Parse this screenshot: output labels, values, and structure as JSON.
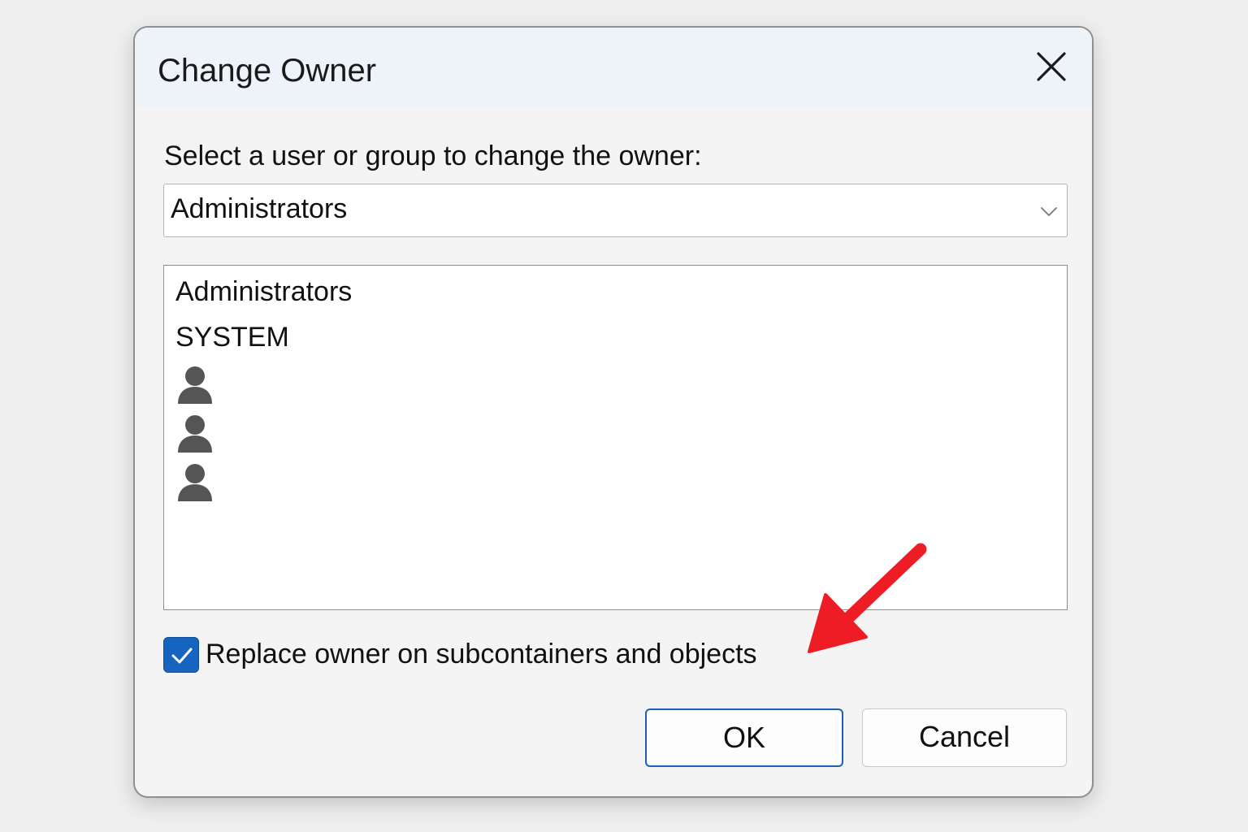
{
  "dialog": {
    "title": "Change Owner",
    "close_icon": "close-icon"
  },
  "owner_select": {
    "prompt": "Select a user or group to change the owner:",
    "selected_value": "Administrators",
    "chevron_icon": "chevron-down-icon"
  },
  "list": {
    "items": [
      {
        "label": "Administrators"
      },
      {
        "label": "SYSTEM"
      },
      {
        "icon": "user-icon"
      },
      {
        "icon": "user-icon"
      },
      {
        "icon": "user-icon"
      }
    ]
  },
  "replace_option": {
    "label": "Replace owner on subcontainers and objects",
    "checked": true,
    "check_color": "#1565c0"
  },
  "buttons": {
    "ok_label": "OK",
    "cancel_label": "Cancel"
  },
  "annotation": {
    "type": "arrow",
    "color": "#ee1c25",
    "points_to": "replace-owner-checkbox"
  }
}
